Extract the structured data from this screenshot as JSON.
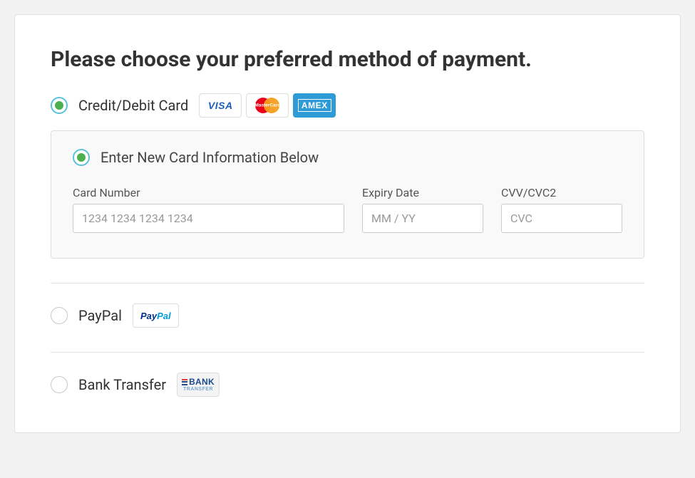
{
  "title": "Please choose your preferred method of payment.",
  "methods": {
    "card": {
      "label": "Credit/Debit Card",
      "selected": true,
      "sub": {
        "label": "Enter New Card Information Below",
        "selected": true,
        "fields": {
          "number": {
            "label": "Card Number",
            "placeholder": "1234 1234 1234 1234"
          },
          "expiry": {
            "label": "Expiry Date",
            "placeholder": "MM / YY"
          },
          "cvc": {
            "label": "CVV/CVC2",
            "placeholder": "CVC"
          }
        }
      }
    },
    "paypal": {
      "label": "PayPal",
      "selected": false
    },
    "bank": {
      "label": "Bank Transfer",
      "selected": false
    }
  },
  "badges": {
    "visa": "VISA",
    "mastercard": "MasterCard",
    "amex": "AMEX",
    "paypal_a": "Pay",
    "paypal_b": "Pal",
    "bank_a": "BANK",
    "bank_b": "TRANSFER"
  }
}
